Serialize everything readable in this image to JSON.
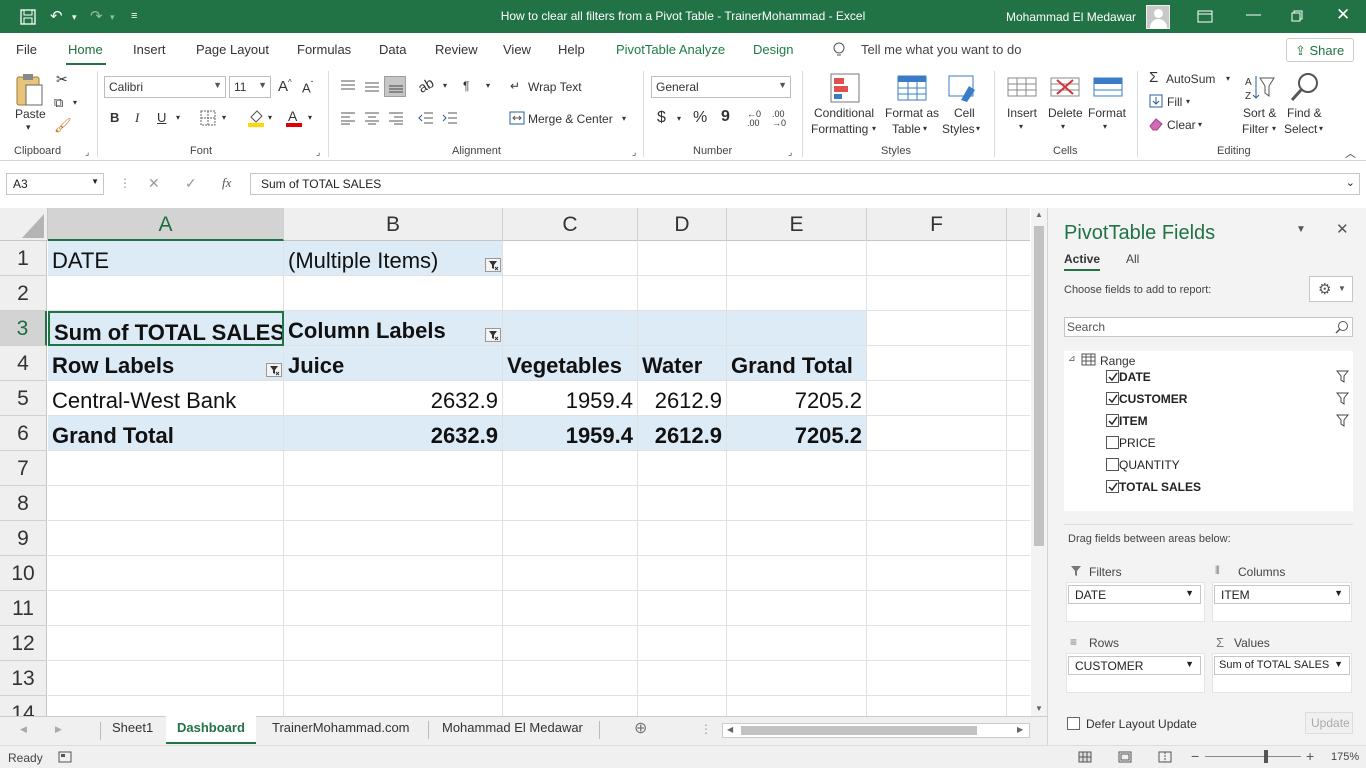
{
  "window": {
    "title": "How to clear all filters from a Pivot Table - TrainerMohammad  -  Excel",
    "user": "Mohammad El Medawar"
  },
  "ribbon_tabs": [
    "File",
    "Home",
    "Insert",
    "Page Layout",
    "Formulas",
    "Data",
    "Review",
    "View",
    "Help",
    "PivotTable Analyze",
    "Design"
  ],
  "tell_me": "Tell me what you want to do",
  "share_label": "Share",
  "ribbon": {
    "paste": "Paste",
    "font_name": "Calibri",
    "font_size": "11",
    "wrap_text": "Wrap Text",
    "merge_center": "Merge & Center",
    "number_format": "General",
    "conditional_formatting": [
      "Conditional",
      "Formatting"
    ],
    "format_as_table": [
      "Format as",
      "Table"
    ],
    "cell_styles": [
      "Cell",
      "Styles"
    ],
    "insert": "Insert",
    "delete": "Delete",
    "format": "Format",
    "autosum": "AutoSum",
    "fill": "Fill",
    "clear": "Clear",
    "sort_filter": [
      "Sort &",
      "Filter"
    ],
    "find_select": [
      "Find &",
      "Select"
    ],
    "groups": [
      "Clipboard",
      "Font",
      "Alignment",
      "Number",
      "Styles",
      "Cells",
      "Editing"
    ],
    "bold": "B",
    "italic": "I",
    "underline": "U",
    "currency": "$",
    "percent": "%",
    "comma": "9"
  },
  "formula_bar": {
    "name_box": "A3",
    "formula": "Sum of TOTAL SALES",
    "fx": "fx"
  },
  "grid": {
    "columns": [
      "A",
      "B",
      "C",
      "D",
      "E",
      "F"
    ],
    "rows": [
      "1",
      "2",
      "3",
      "4",
      "5",
      "6",
      "7",
      "8",
      "9",
      "10",
      "11",
      "12",
      "13",
      "14"
    ],
    "cells": {
      "A1": "DATE",
      "B1": "(Multiple Items)",
      "A3": "Sum of TOTAL SALES",
      "B3": "Column Labels",
      "A4": "Row Labels",
      "B4": "Juice",
      "C4": "Vegetables",
      "D4": "Water",
      "E4": "Grand Total",
      "A5": "Central-West Bank",
      "B5": "2632.9",
      "C5": "1959.4",
      "D5": "2612.9",
      "E5": "7205.2",
      "A6": "Grand Total",
      "B6": "2632.9",
      "C6": "1959.4",
      "D6": "2612.9",
      "E6": "7205.2"
    }
  },
  "sheet_tabs": [
    "Sheet1",
    "Dashboard",
    "TrainerMohammad.com",
    "Mohammad El Medawar"
  ],
  "status": {
    "ready": "Ready",
    "zoom": "175%"
  },
  "pivot_pane": {
    "title": "PivotTable Fields",
    "tabs": [
      "Active",
      "All"
    ],
    "choose_fields": "Choose fields to add to report:",
    "search_placeholder": "Search",
    "range": "Range",
    "fields": [
      {
        "name": "DATE",
        "checked": true,
        "filtered": true
      },
      {
        "name": "CUSTOMER",
        "checked": true,
        "filtered": true
      },
      {
        "name": "ITEM",
        "checked": true,
        "filtered": true
      },
      {
        "name": "PRICE",
        "checked": false,
        "filtered": false
      },
      {
        "name": "QUANTITY",
        "checked": false,
        "filtered": false
      },
      {
        "name": "TOTAL SALES",
        "checked": true,
        "filtered": false
      }
    ],
    "drag_hint": "Drag fields between areas below:",
    "areas": {
      "filters_label": "Filters",
      "filters_value": "DATE",
      "columns_label": "Columns",
      "columns_value": "ITEM",
      "rows_label": "Rows",
      "rows_value": "CUSTOMER",
      "values_label": "Values",
      "values_value": "Sum of TOTAL SALES"
    },
    "defer_label": "Defer Layout Update",
    "update_label": "Update"
  }
}
